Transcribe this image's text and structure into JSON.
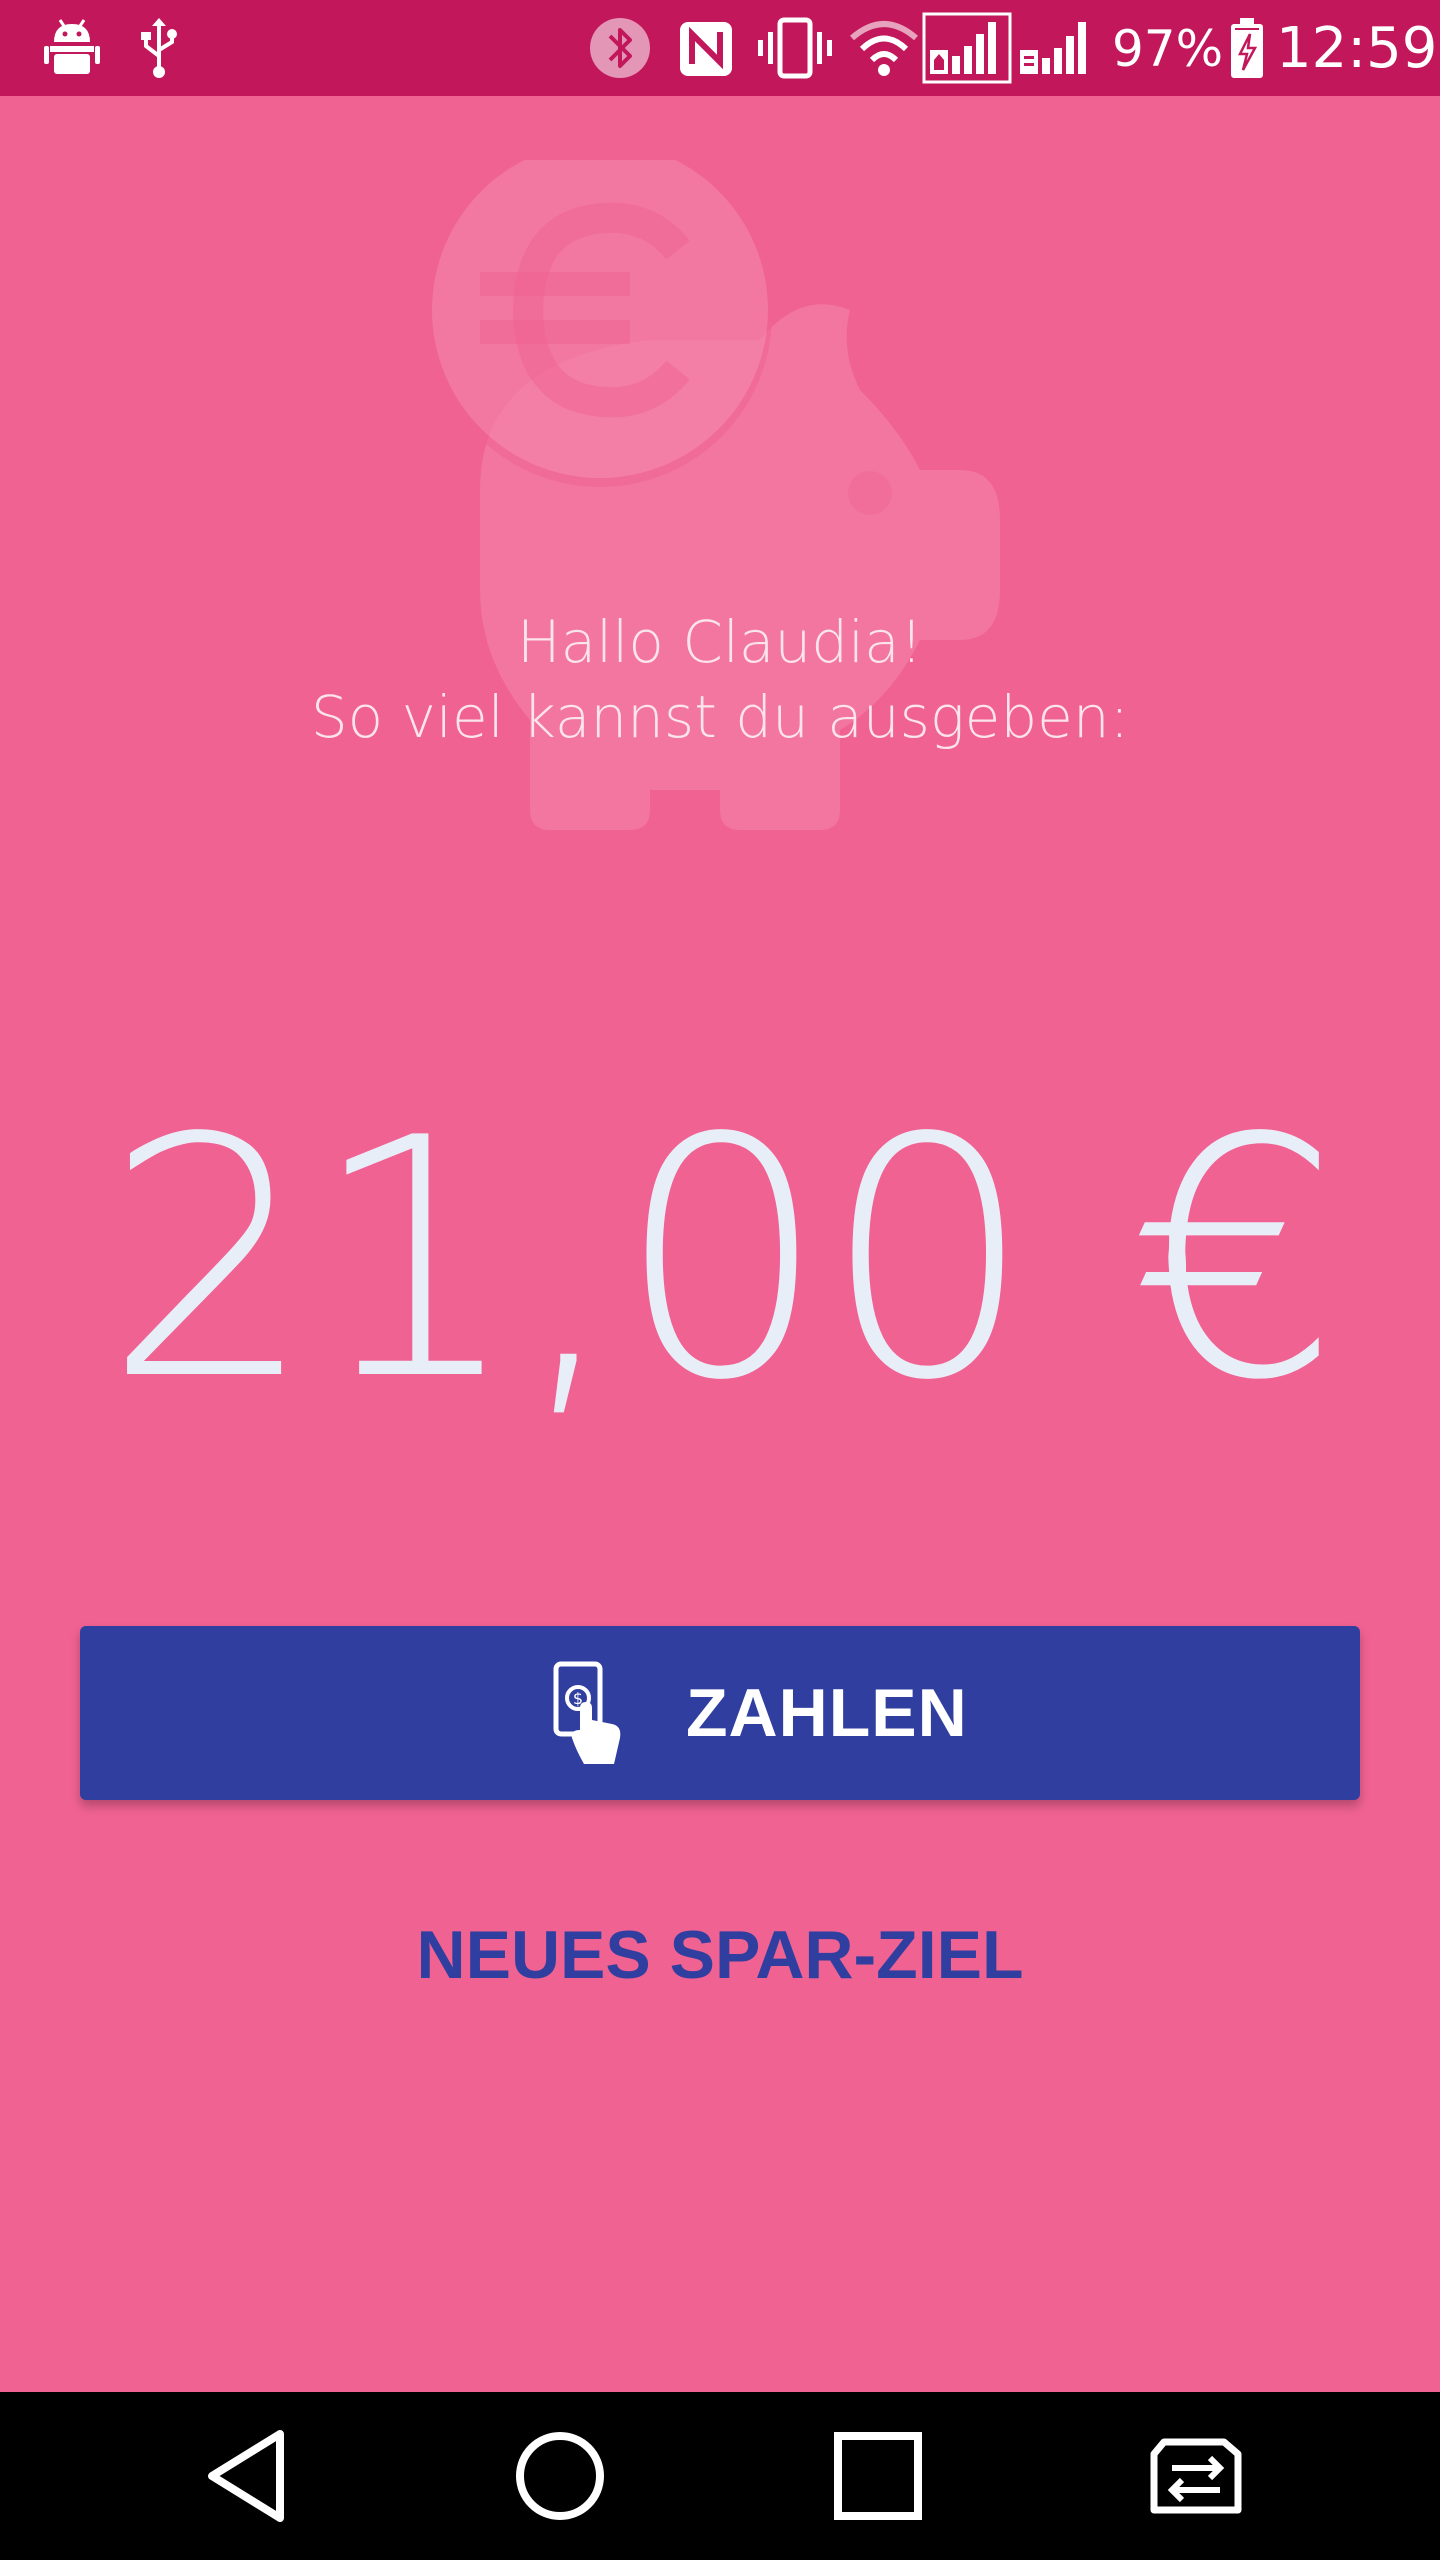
{
  "status_bar": {
    "battery_percent": "97%",
    "time": "12:59",
    "icons": [
      "android-debug-icon",
      "usb-icon",
      "bluetooth-icon",
      "nfc-icon",
      "vibrate-icon",
      "wifi-icon",
      "signal-sim1-icon",
      "signal-sim2-icon",
      "battery-charging-icon"
    ]
  },
  "greeting": {
    "line1": "Hallo Claudia!",
    "line2": "So viel kannst du ausgeben:"
  },
  "balance": {
    "amount": "21,00",
    "currency": "€"
  },
  "actions": {
    "pay_label": "ZAHLEN",
    "new_goal_label": "NEUES SPAR-ZIEL"
  },
  "navigation": {
    "items": [
      "back-icon",
      "home-icon",
      "recents-icon",
      "switch-sim-icon"
    ]
  },
  "colors": {
    "background": "#f06292",
    "status_bar": "#c2185b",
    "primary": "#303f9f",
    "nav_bar": "#000000"
  }
}
